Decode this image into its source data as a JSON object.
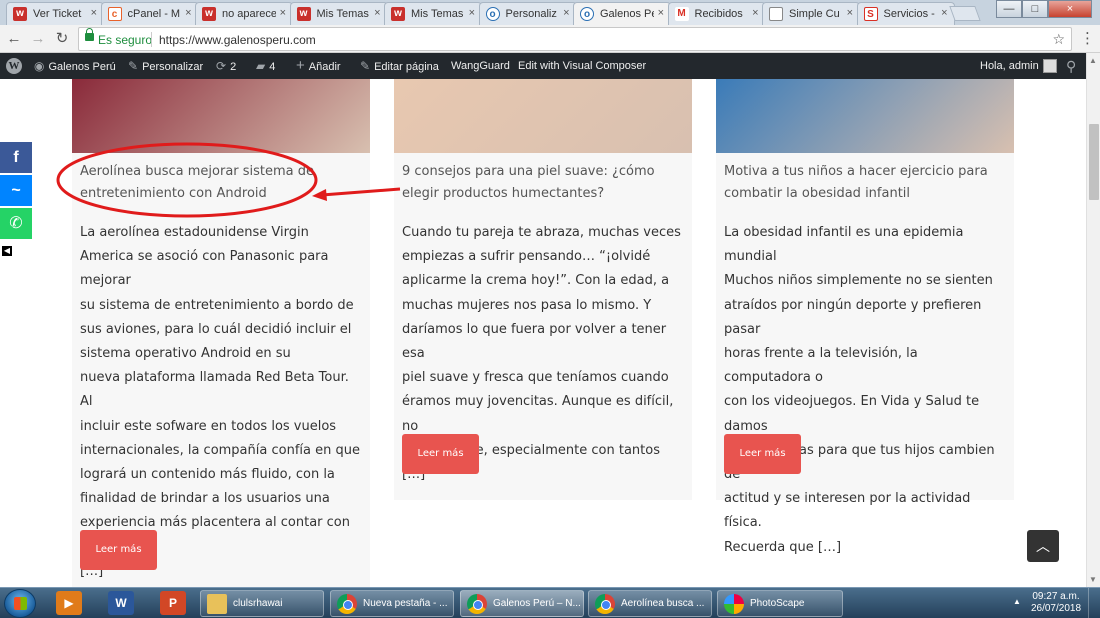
{
  "browser": {
    "tabs": [
      {
        "label": "Ver Ticket",
        "favicon": "w",
        "fav_class": "fav-w"
      },
      {
        "label": "cPanel - M",
        "favicon": "c",
        "fav_class": "fav-c"
      },
      {
        "label": "no aparece",
        "favicon": "w",
        "fav_class": "fav-w"
      },
      {
        "label": "Mis Temas",
        "favicon": "w",
        "fav_class": "fav-w"
      },
      {
        "label": "Mis Temas",
        "favicon": "w",
        "fav_class": "fav-w"
      },
      {
        "label": "Personaliz",
        "favicon": "o",
        "fav_class": "fav-o"
      },
      {
        "label": "Galenos Pe",
        "favicon": "o",
        "fav_class": "fav-o",
        "active": true
      },
      {
        "label": "Recibidos",
        "favicon": "M",
        "fav_class": "fav-m"
      },
      {
        "label": "Simple Cu",
        "favicon": "",
        "fav_class": "fav-d"
      },
      {
        "label": "Servicios -",
        "favicon": "S",
        "fav_class": "fav-s"
      }
    ],
    "tab_close": "×",
    "window_buttons": {
      "minimize": "—",
      "maximize": "□",
      "close": "×"
    },
    "nav": {
      "back": "←",
      "forward": "→",
      "reload": "↻"
    },
    "secure_label": "Es seguro",
    "url": "https://www.galenosperu.com",
    "star": "☆",
    "menu": "⋮"
  },
  "admin_bar": {
    "site_name": "Galenos Perú",
    "customize": "Personalizar",
    "updates_count": "2",
    "comments_count": "4",
    "add_new": "Añadir",
    "edit_page": "Editar página",
    "wangguard": "WangGuard",
    "visual_composer": "Edit with Visual Composer",
    "greeting": "Hola, admin",
    "icons": {
      "logo": "W",
      "customize": "✎",
      "updates": "⟳",
      "comments": "▰",
      "add": "+",
      "edit": "✎",
      "search": "⚲"
    }
  },
  "posts": [
    {
      "title": "Aerolínea busca mejorar sistema de entretenimiento con Android",
      "excerpt": [
        "La aerolínea estadounidense Virgin",
        "America se asoció con Panasonic para mejorar",
        "su sistema de entretenimiento a bordo de",
        "sus aviones, para lo cuál decidió incluir el",
        "sistema operativo Android en su",
        "nueva plataforma llamada Red Beta Tour. Al",
        "incluir este sofware en todos los vuelos",
        "internacionales, la compañía confía en que",
        "logrará un contenido más fluido, con la",
        "finalidad de brindar a los usuarios una",
        "experiencia más placentera al contar con un",
        "[…]"
      ],
      "button": "Leer más",
      "thumb_color": "#8a2a3a"
    },
    {
      "title": "9 consejos para una piel suave: ¿cómo elegir productos humectantes?",
      "excerpt": [
        "Cuando tu pareja te abraza, muchas veces",
        "empiezas a sufrir pensando… “¡olvidé",
        "aplicarme la crema hoy!”. Con la edad, a",
        "muchas mujeres nos pasa lo mismo. Y",
        "daríamos lo que fuera por volver a tener esa",
        "piel suave y fresca que teníamos cuando",
        "éramos muy jovencitas. Aunque es difícil, no",
        "es imposible, especialmente con tantos […]"
      ],
      "button": "Leer más",
      "thumb_color": "#e8c8b0"
    },
    {
      "title": "Motiva a tus niños a hacer ejercicio para combatir la obesidad infantil",
      "excerpt": [
        "La obesidad infantil es una epidemia mundial",
        "Muchos niños simplemente no se sienten",
        "atraídos por ningún deporte y prefieren pasar",
        "horas frente a la televisión, la computadora o",
        "con los videojuegos. En Vida y Salud te damos",
        "algunas ideas para que tus hijos cambien de",
        "actitud y se interesen por la actividad física.",
        "Recuerda que […]"
      ],
      "button": "Leer más",
      "thumb_color": "#3a7bb8"
    }
  ],
  "share": {
    "facebook": "f",
    "messenger": "~",
    "whatsapp": "✆",
    "minimize": "◀"
  },
  "scroll_top": "︿",
  "scrollbar": {
    "up": "▲",
    "down": "▼"
  },
  "taskbar": {
    "pinned": [
      {
        "name": "media-player-icon",
        "glyph": "▶",
        "color": "#e07b1a"
      },
      {
        "name": "word-icon",
        "glyph": "W",
        "color": "#2b579a"
      },
      {
        "name": "powerpoint-icon",
        "glyph": "P",
        "color": "#d24726"
      }
    ],
    "windows": [
      {
        "label": "clulsrhawai",
        "icon": "ti-folder"
      },
      {
        "label": "Nueva pestaña - ...",
        "icon": "ti-chrome"
      },
      {
        "label": "Galenos Perú – N...",
        "icon": "ti-chrome",
        "active": true
      },
      {
        "label": "Aerolínea busca ...",
        "icon": "ti-chrome"
      },
      {
        "label": "PhotoScape",
        "icon": "ti-ps"
      }
    ],
    "tray_arrow": "▲",
    "time": "09:27 a.m.",
    "date": "26/07/2018"
  }
}
